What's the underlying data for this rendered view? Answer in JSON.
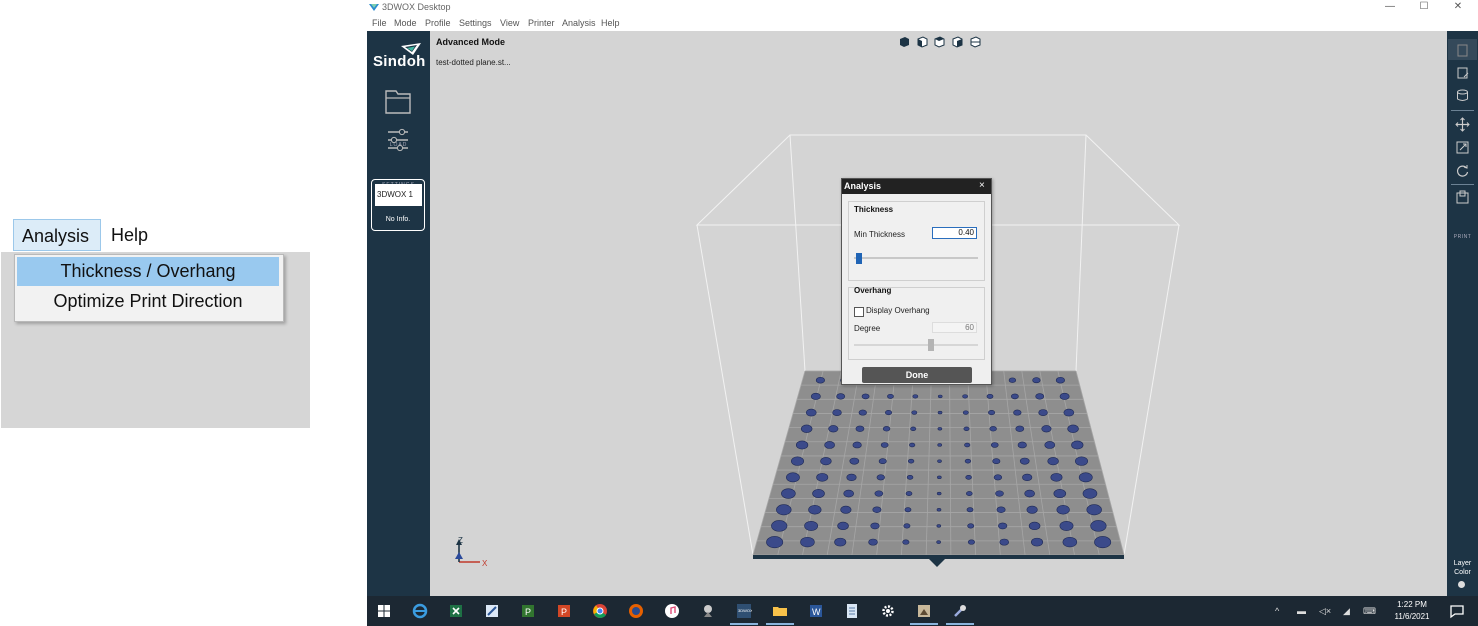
{
  "inset": {
    "menu": [
      "Analysis",
      "Help"
    ],
    "dropdown": [
      "Thickness / Overhang",
      "Optimize Print Direction"
    ]
  },
  "window": {
    "title": "3DWOX Desktop",
    "controls": [
      "—",
      "☐",
      "✕"
    ]
  },
  "menubar": [
    "File",
    "Mode",
    "Profile",
    "Settings",
    "View",
    "Printer",
    "Analysis",
    "Help"
  ],
  "sidebar": {
    "brand": "Sindoh",
    "load_label": "LOAD",
    "settings_label": "SETTINGS",
    "printer_name": "3DWOX 1",
    "printer_info": "No Info."
  },
  "viewport": {
    "mode": "Advanced Mode",
    "file": "test-dotted plane.st..."
  },
  "right_sidebar": {
    "print_label": "PRINT",
    "layer_color_line1": "Layer",
    "layer_color_line2": "Color"
  },
  "dialog": {
    "title": "Analysis",
    "close": "×",
    "thickness_group": "Thickness",
    "min_thickness_label": "Min Thickness",
    "min_thickness_value": "0.40",
    "thickness_slider_level": 0.04,
    "overhang_group": "Overhang",
    "display_overhang_label": "Display Overhang",
    "display_overhang_checked": false,
    "degree_label": "Degree",
    "degree_value": "60",
    "degree_slider_level": 0.62,
    "done_label": "Done"
  },
  "axes": {
    "z": "Z",
    "x": "X"
  },
  "taskbar": {
    "time": "1:22 PM",
    "date": "11/6/2021"
  },
  "colors": {
    "sidebar": "#1d3445",
    "viewport": "#d4d4d4",
    "highlight": "#99c9ef",
    "bed": "#8e8e8e",
    "dot": "#3b4a8a"
  }
}
